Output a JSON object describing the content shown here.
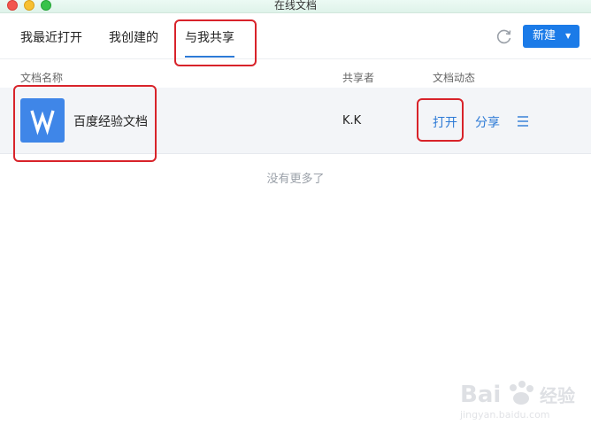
{
  "window": {
    "title": "在线文档"
  },
  "tabs": [
    {
      "label": "我最近打开"
    },
    {
      "label": "我创建的"
    },
    {
      "label": "与我共享"
    }
  ],
  "toolbar": {
    "new_label": "新建",
    "new_caret": "▼"
  },
  "columns": {
    "name": "文档名称",
    "sharer": "共享者",
    "activity": "文档动态"
  },
  "rows": [
    {
      "name": "百度经验文档",
      "sharer": "K.K",
      "open": "打开",
      "share": "分享",
      "icon": "W"
    }
  ],
  "list": {
    "end_text": "没有更多了"
  },
  "colors": {
    "accent": "#1b7be8",
    "annotation": "#d8232a",
    "doc_icon": "#3f86e8"
  },
  "watermark": {
    "brand": "Bai du 经验",
    "url": "jingyan.baidu.com"
  }
}
